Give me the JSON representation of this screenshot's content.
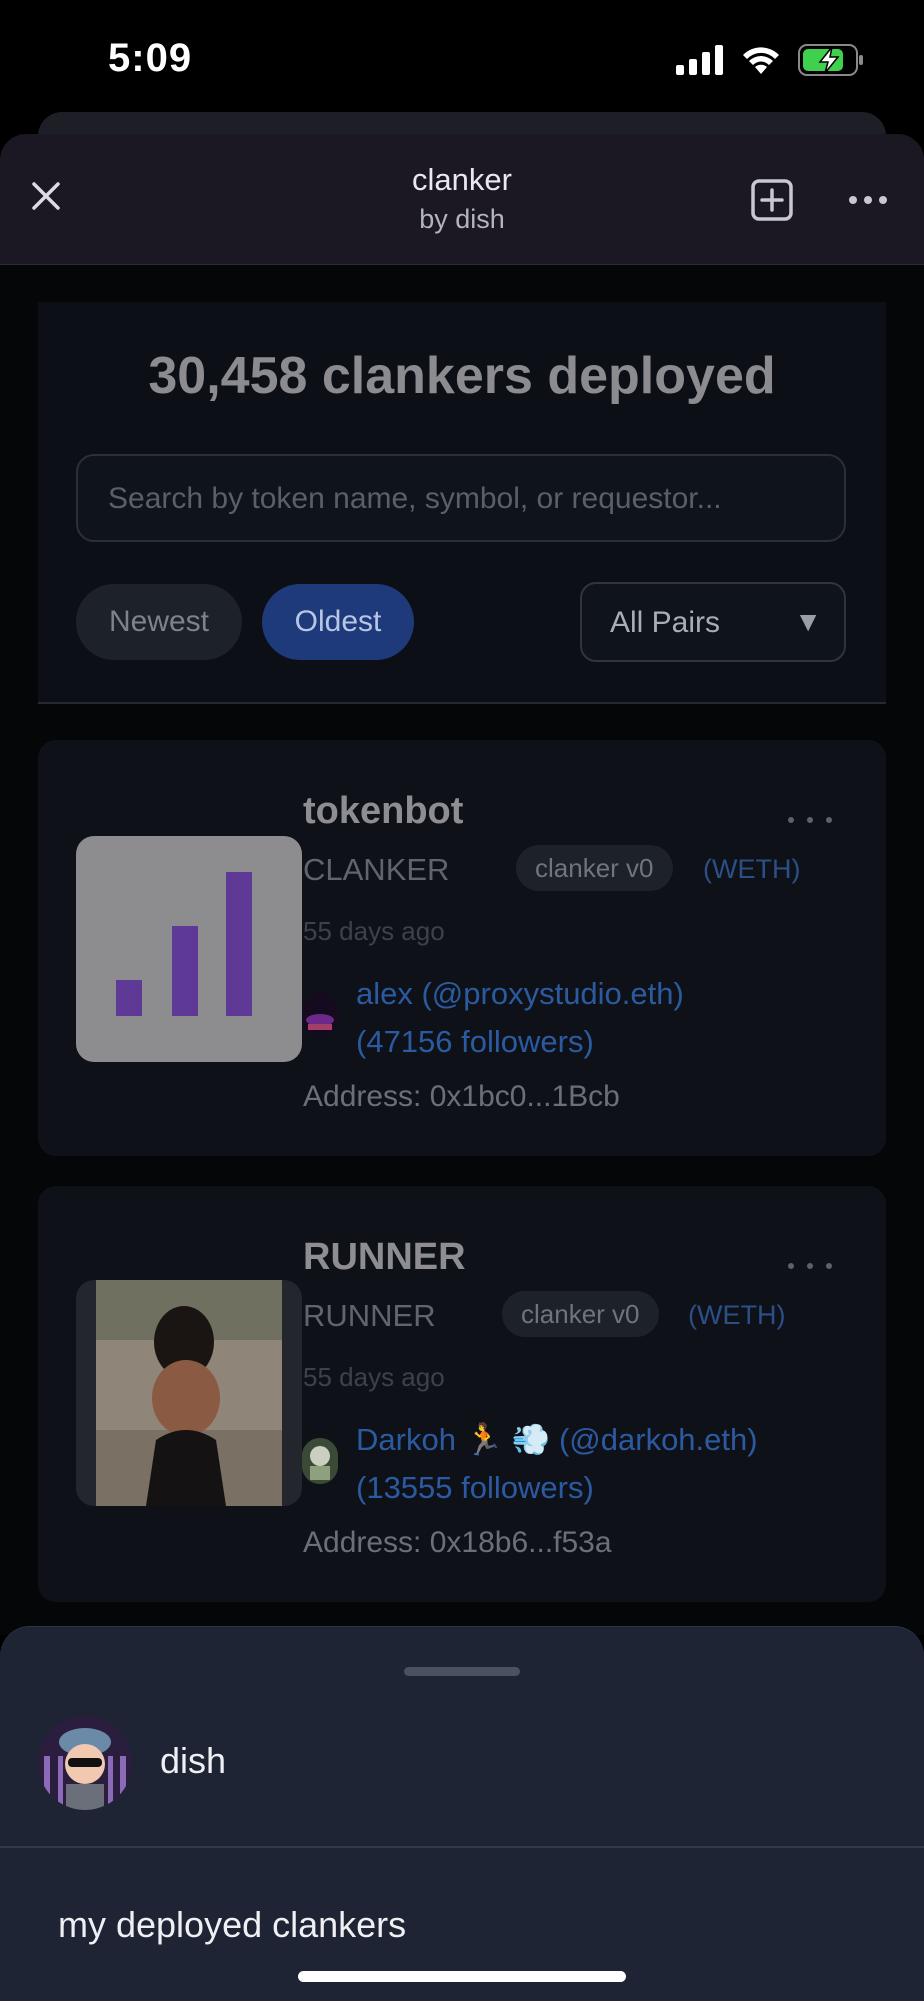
{
  "status_bar": {
    "time": "5:09",
    "icons": [
      "signal-icon",
      "wifi-icon",
      "battery-charging-icon"
    ]
  },
  "header": {
    "title": "clanker",
    "subtitle": "by dish",
    "close_icon": "close-icon",
    "add_icon": "add-square-icon",
    "more_icon": "more-horizontal-icon"
  },
  "main": {
    "count_title": "30,458 clankers deployed",
    "search": {
      "placeholder": "Search by token name, symbol, or requestor...",
      "value": ""
    },
    "sort": {
      "newest": "Newest",
      "oldest": "Oldest",
      "selected": "Oldest"
    },
    "pairs_filter": {
      "selected": "All Pairs"
    }
  },
  "tokens": [
    {
      "name": "tokenbot",
      "symbol": "CLANKER",
      "version": "clanker v0",
      "pair": "(WETH)",
      "age": "55 days ago",
      "requestor_line1": "alex (@proxystudio.eth)",
      "requestor_line2": "(47156 followers)",
      "address": "Address: 0x1bc0...1Bcb"
    },
    {
      "name": "RUNNER",
      "symbol": "RUNNER",
      "version": "clanker v0",
      "pair": "(WETH)",
      "age": "55 days ago",
      "requestor_line1": "Darkoh 🏃 💨 (@darkoh.eth)",
      "requestor_line2": "(13555 followers)",
      "address": "Address: 0x18b6...f53a"
    }
  ],
  "sheet": {
    "user_name": "dish",
    "item": "my deployed clankers"
  },
  "colors": {
    "accent_selected": "#1e3a7a",
    "link": "#2c5aa0",
    "sheet_bg": "#1e2433",
    "header_bg": "#1b1723"
  }
}
